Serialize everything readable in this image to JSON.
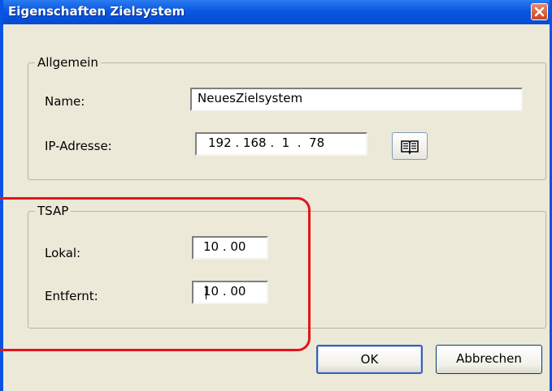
{
  "window": {
    "title": "Eigenschaften Zielsystem"
  },
  "allgemein": {
    "legend": "Allgemein",
    "name_label": "Name:",
    "name_value": "NeuesZielsystem",
    "ip_label": "IP-Adresse:",
    "ip_value": "192 . 168 .  1  .  78",
    "browse_icon": "open-book-icon"
  },
  "tsap": {
    "legend": "TSAP",
    "lokal_label": "Lokal:",
    "lokal_value": "10 . 00",
    "entfernt_label": "Entfernt:",
    "entfernt_value": "10 . 00"
  },
  "buttons": {
    "ok": "OK",
    "cancel": "Abbrechen"
  },
  "colors": {
    "titlebar": "#0a57df",
    "highlight": "#e3151b",
    "dialog_bg": "#ece9d8"
  }
}
